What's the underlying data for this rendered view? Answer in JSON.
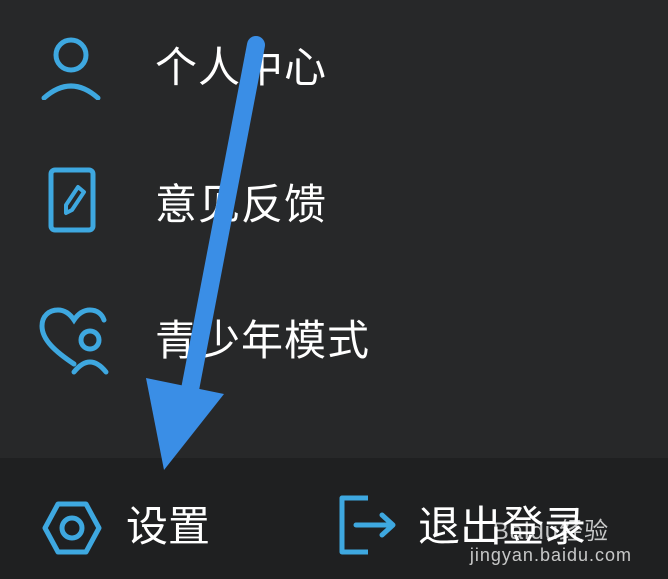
{
  "menu": {
    "items": [
      {
        "label": "个人中心",
        "icon": "person-icon"
      },
      {
        "label": "意见反馈",
        "icon": "feedback-pencil-icon"
      },
      {
        "label": "青少年模式",
        "icon": "heart-person-icon"
      }
    ]
  },
  "bottom_bar": {
    "settings_label": "设置",
    "settings_icon": "hexagon-settings-icon",
    "logout_label": "退出登录",
    "logout_icon": "logout-icon"
  },
  "annotation": {
    "type": "arrow-pointing-down-left",
    "color": "#3a8ee6"
  },
  "watermark": {
    "brand": "Baidu经验",
    "url": "jingyan.baidu.com"
  },
  "colors": {
    "background": "#272829",
    "bottom_bar_background": "#1f2021",
    "icon_accent": "#3ea8e0",
    "text": "#ffffff"
  }
}
